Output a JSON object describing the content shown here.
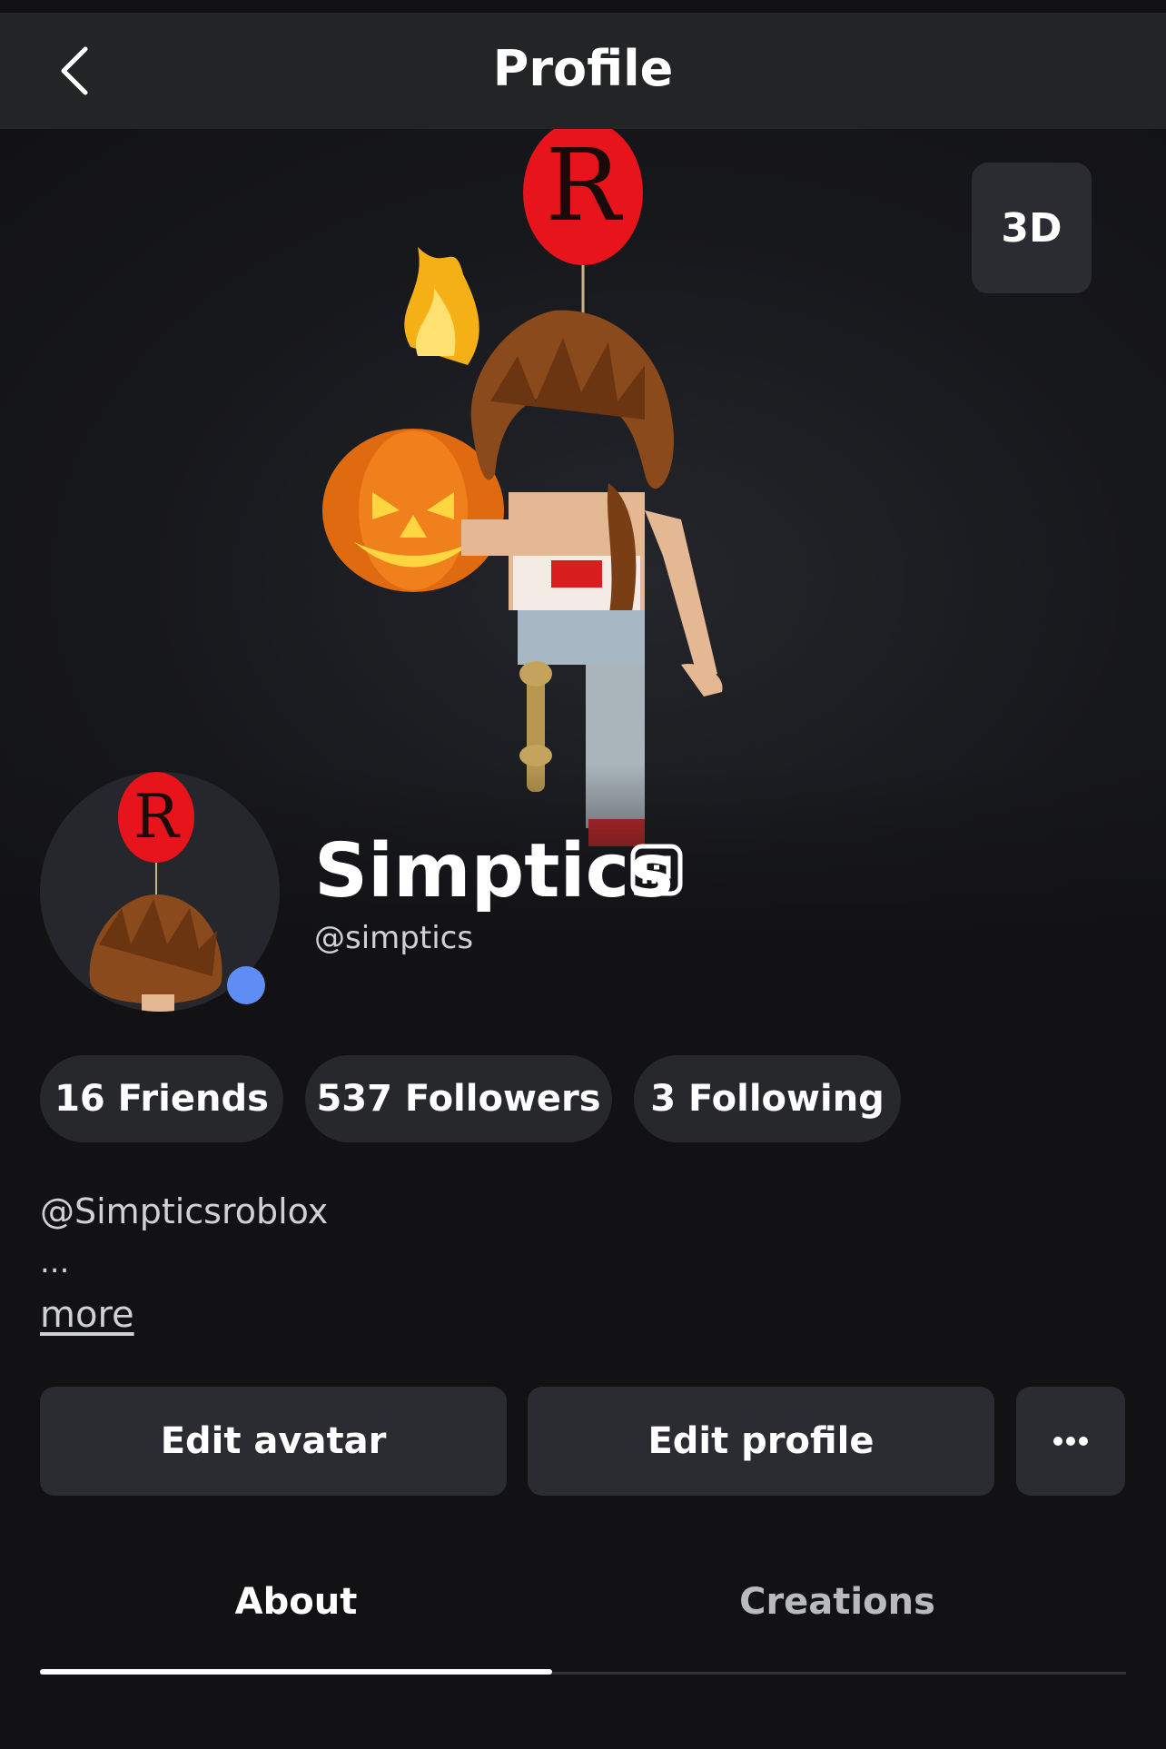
{
  "header": {
    "title": "Profile",
    "back_icon": "chevron-left-icon"
  },
  "hero": {
    "view_toggle_label": "3D"
  },
  "profile": {
    "display_name": "Simptics",
    "username": "@simptics",
    "premium_icon": "premium-badge-icon",
    "online_status_color": "#5e8ef5"
  },
  "stats": {
    "friends": "16 Friends",
    "followers": "537 Followers",
    "following": "3 Following"
  },
  "bio": {
    "line1": "@Simpticsroblox",
    "ellipsis": "...",
    "more_label": "more"
  },
  "actions": {
    "edit_avatar": "Edit avatar",
    "edit_profile": "Edit profile",
    "more_icon": "more-horizontal-icon"
  },
  "tabs": [
    {
      "label": "About",
      "active": true
    },
    {
      "label": "Creations",
      "active": false
    }
  ]
}
